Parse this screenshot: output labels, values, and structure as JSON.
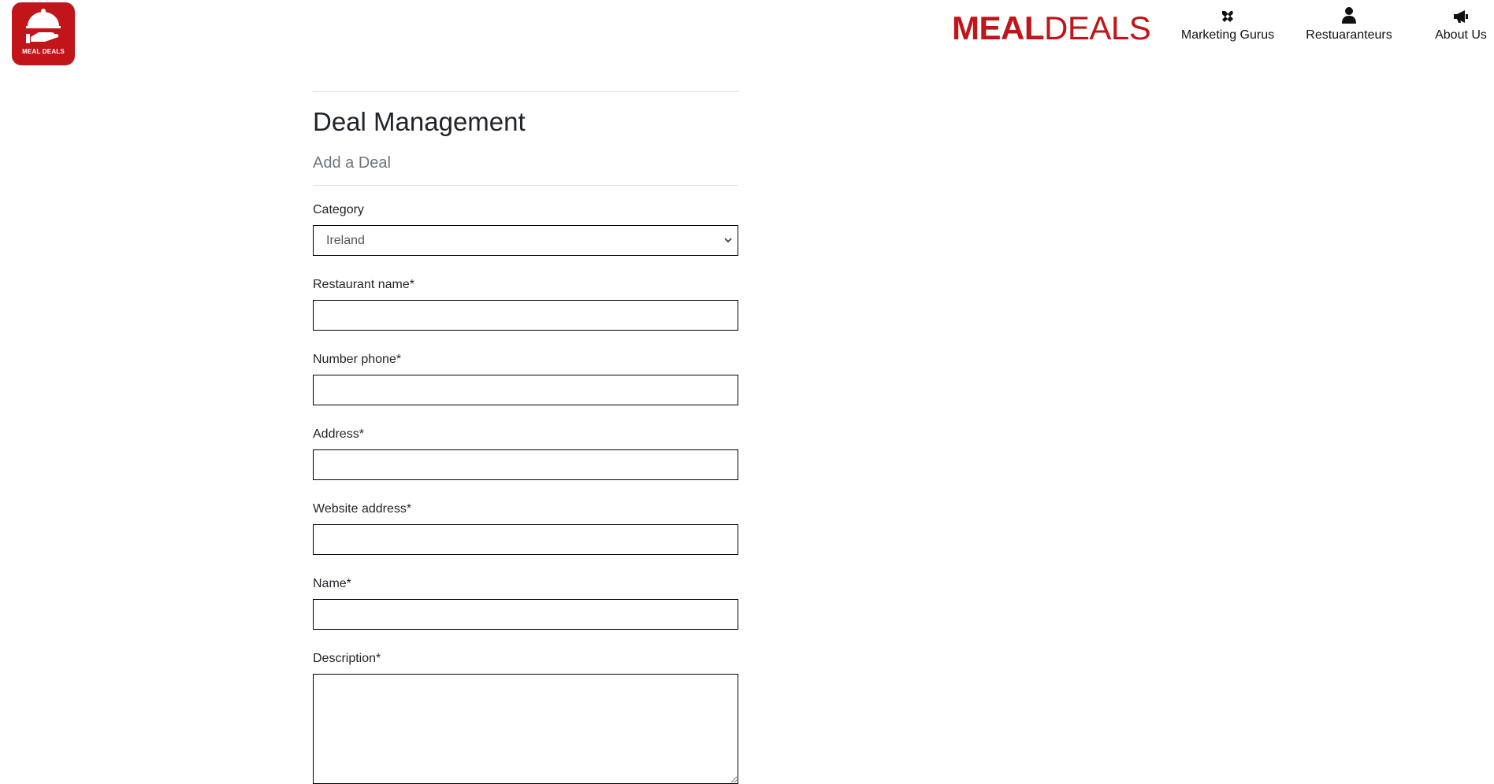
{
  "brand": {
    "logo_text": "MEAL DEALS",
    "name_bold": "MEAL",
    "name_regular": "DEALS",
    "color": "#c1151a"
  },
  "nav": {
    "items": [
      {
        "label": "Marketing Gurus",
        "icon": "tools-icon"
      },
      {
        "label": "Restuaranteurs",
        "icon": "person-icon"
      },
      {
        "label": "About Us",
        "icon": "megaphone-icon"
      }
    ]
  },
  "page": {
    "title": "Deal Management",
    "subtitle": "Add a Deal"
  },
  "form": {
    "category": {
      "label": "Category",
      "value": "Ireland"
    },
    "restaurant_name": {
      "label": "Restaurant name*",
      "value": ""
    },
    "number_phone": {
      "label": "Number phone*",
      "value": ""
    },
    "address": {
      "label": "Address*",
      "value": ""
    },
    "website_address": {
      "label": "Website address*",
      "value": ""
    },
    "name": {
      "label": "Name*",
      "value": ""
    },
    "description": {
      "label": "Description*",
      "value": ""
    }
  }
}
